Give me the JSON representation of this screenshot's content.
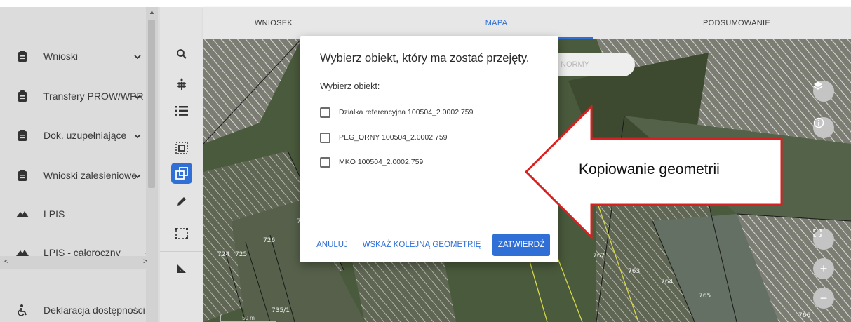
{
  "sidebar": {
    "items": [
      {
        "label": "Wnioski",
        "icon": "clipboard-icon",
        "has_chevron": true
      },
      {
        "label": "Transfery PROW/WPR",
        "icon": "clipboard-icon",
        "has_chevron": true
      },
      {
        "label": "Dok. uzupełniające",
        "icon": "clipboard-icon",
        "has_chevron": true
      },
      {
        "label": "Wnioski zalesieniowe",
        "icon": "clipboard-icon",
        "has_chevron": true
      },
      {
        "label": "LPIS",
        "icon": "terrain-icon",
        "has_chevron": false
      },
      {
        "label": "LPIS - całoroczny",
        "icon": "terrain-icon",
        "has_chevron": true
      }
    ],
    "footer_label": "Deklaracja dostępności",
    "footer_icon": "accessibility-icon",
    "scroll_left": "<",
    "scroll_right": ">"
  },
  "toolbar": {
    "tools": [
      "search-icon",
      "plant-icon",
      "list-icon",
      "select-area-icon",
      "copy-geometry-icon",
      "pencil-icon",
      "rectangle-select-icon",
      "measure-icon"
    ],
    "active_tool": "copy-geometry-icon"
  },
  "tabs": [
    {
      "label": "WNIOSEK",
      "active": false
    },
    {
      "label": "MAPA",
      "active": true
    },
    {
      "label": "PODSUMOWANIE",
      "active": false
    }
  ],
  "map": {
    "normy_label": "NORMY",
    "scale_label": "50 m",
    "parcel_numbers": [
      "724",
      "725",
      "726",
      "735/1",
      "762",
      "763",
      "764",
      "765",
      "766",
      "73"
    ]
  },
  "modal": {
    "title": "Wybierz obiekt, który ma zostać przejęty.",
    "subtitle": "Wybierz obiekt:",
    "options": [
      {
        "label": "Działka referencyjna 100504_2.0002.759",
        "checked": false
      },
      {
        "label": "PEG_ORNY 100504_2.0002.759",
        "checked": false
      },
      {
        "label": "MKO 100504_2.0002.759",
        "checked": false
      }
    ],
    "buttons": {
      "cancel": "ANULUJ",
      "next": "WSKAŻ KOLEJNĄ GEOMETRIĘ",
      "confirm": "ZATWIERDŹ"
    }
  },
  "callout": {
    "text": "Kopiowanie geometrii",
    "border_color": "#d92020"
  },
  "colors": {
    "accent": "#2f6fd6",
    "sidebar_bg": "#dcdcdc",
    "toolbar_bg": "#e4e4e4"
  }
}
